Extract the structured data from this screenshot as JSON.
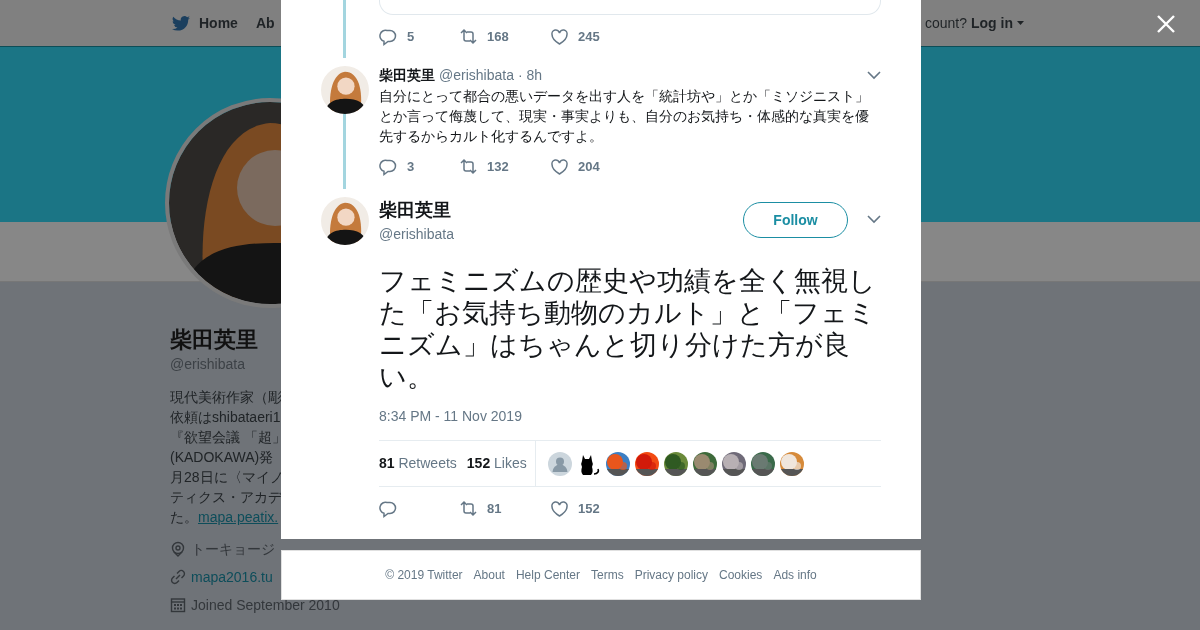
{
  "top_nav": {
    "items": [
      {
        "label": "Home",
        "kind": "home"
      },
      {
        "label": "Ab",
        "kind": "plain"
      }
    ],
    "account_prompt": "count?",
    "login": "Log in"
  },
  "profile": {
    "name": "柴田英里",
    "handle": "@erishibata",
    "bio_lines": [
      "現代美術作家（彫",
      "依頼はshibataeri1",
      "『欲望会議 「超」",
      "(KADOKAWA)発",
      "月28日に〈マイノ",
      "ティクス・アカデ",
      "た。"
    ],
    "bio_link": "mapa.peatix.",
    "location": "トーキョージ",
    "website": "mapa2016.tu",
    "joined": "Joined September 2010"
  },
  "modal": {
    "quoted_actions": {
      "replies": "5",
      "retweets": "168",
      "likes": "245"
    },
    "reply": {
      "name": "柴田英里",
      "handle": "@erishibata",
      "time": "· 8h",
      "text": "自分にとって都合の悪いデータを出す人を「統計坊や」とか「ミソジニスト」とか言って侮蔑して、現実・事実よりも、自分のお気持ち・体感的な真実を優先するからカルト化するんですよ。",
      "actions": {
        "replies": "3",
        "retweets": "132",
        "likes": "204"
      }
    },
    "main_tweet": {
      "name": "柴田英里",
      "handle": "@erishibata",
      "follow": "Follow",
      "text": "フェミニズムの歴史や功績を全く無視した「お気持ち動物のカルト」と「フェミニズム」はちゃんと切り分けた方が良い。",
      "timestamp": "8:34 PM - 11 Nov 2019",
      "retweet_count": "81",
      "retweet_label": "Retweets",
      "like_count": "152",
      "like_label": "Likes",
      "likers": [
        {
          "kind": "default"
        },
        {
          "kind": "cat"
        },
        {
          "kind": "picture"
        },
        {
          "kind": "picture"
        },
        {
          "kind": "picture"
        },
        {
          "kind": "picture"
        },
        {
          "kind": "picture"
        },
        {
          "kind": "picture"
        },
        {
          "kind": "picture"
        }
      ],
      "actions": {
        "retweets": "81",
        "likes": "152"
      }
    }
  },
  "footer": {
    "links": [
      "© 2019 Twitter",
      "About",
      "Help Center",
      "Terms",
      "Privacy policy",
      "Cookies",
      "Ads info"
    ]
  }
}
